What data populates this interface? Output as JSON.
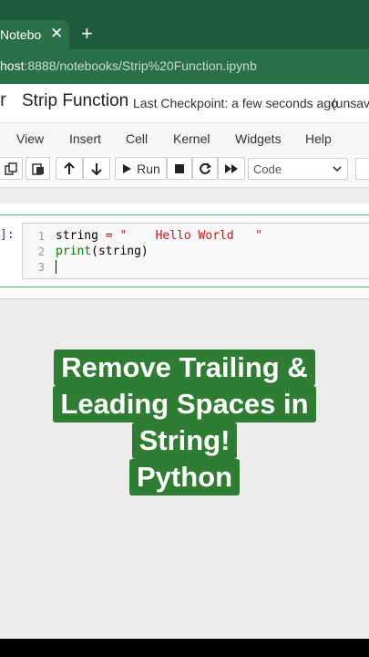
{
  "browser": {
    "tab_title": "Notebook",
    "tab_close_icon": "close-icon",
    "new_tab_icon": "plus-icon",
    "url_host": "host",
    "url_rest": ":8888/notebooks/Strip%20Function.ipynb"
  },
  "notebook": {
    "logo_fragment": "r",
    "title": "Strip Function",
    "checkpoint": "Last Checkpoint: a few seconds ago",
    "unsaved": "(unsave"
  },
  "menu": {
    "items": [
      "View",
      "Insert",
      "Cell",
      "Kernel",
      "Widgets",
      "Help"
    ]
  },
  "toolbar": {
    "run_label": "Run",
    "cell_type": "Code"
  },
  "cell": {
    "prompt": "]:",
    "lines": [
      {
        "num": "1",
        "parts": [
          "string",
          " = ",
          "\"    Hello World   \""
        ]
      },
      {
        "num": "2",
        "parts": [
          "print",
          "(string)"
        ]
      },
      {
        "num": "3",
        "parts": []
      }
    ]
  },
  "caption": {
    "lines": [
      "Remove Trailing &",
      "Leading Spaces in",
      "String!",
      "Python"
    ]
  },
  "colors": {
    "browser_dark": "#1e5a3c",
    "browser_light": "#2a7149",
    "caption_bg": "#2e7d32",
    "cell_border": "#66bb6a"
  }
}
